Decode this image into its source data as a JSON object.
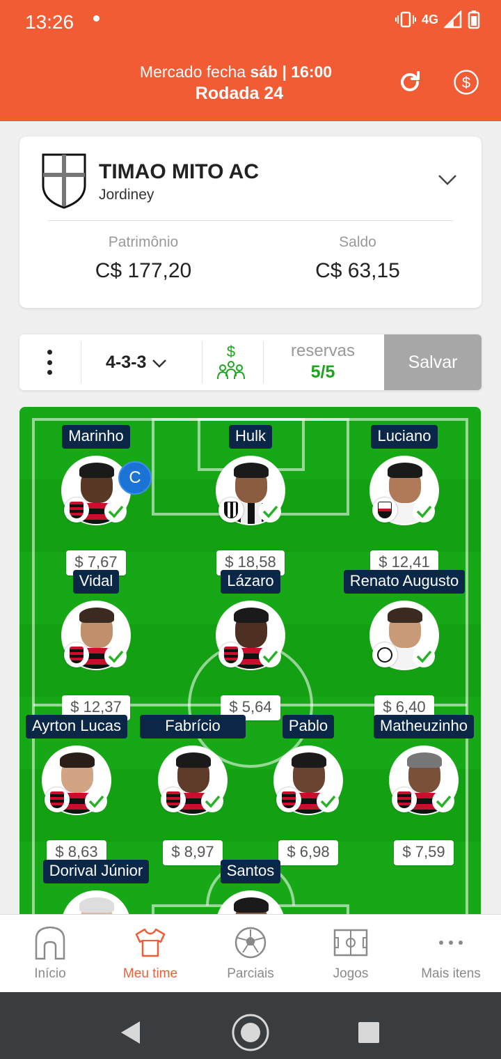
{
  "status_bar": {
    "time": "13:26",
    "network": "4G"
  },
  "header": {
    "market_label": "Mercado fecha",
    "market_time": "sáb | 16:00",
    "round": "Rodada 24"
  },
  "team": {
    "name": "TIMAO MITO AC",
    "owner": "Jordiney",
    "patrimonio_label": "Patrimônio",
    "patrimonio_value": "C$ 177,20",
    "saldo_label": "Saldo",
    "saldo_value": "C$ 63,15"
  },
  "toolbar": {
    "formation": "4-3-3",
    "reserves_label": "reservas",
    "reserves_value": "5/5",
    "save_label": "Salvar"
  },
  "players": [
    {
      "name": "Marinho",
      "price": "$ 7,67",
      "club": "fla",
      "captain": "C"
    },
    {
      "name": "Hulk",
      "price": "$ 18,58",
      "club": "cam"
    },
    {
      "name": "Luciano",
      "price": "$ 12,41",
      "club": "spfc"
    },
    {
      "name": "Vidal",
      "price": "$ 12,37",
      "club": "fla"
    },
    {
      "name": "Lázaro",
      "price": "$ 5,64",
      "club": "fla"
    },
    {
      "name": "Renato Augusto",
      "price": "$ 6,40",
      "club": "sccp"
    },
    {
      "name": "Ayrton Lucas",
      "price": "$ 8,63",
      "club": "fla"
    },
    {
      "name": "Fabrício",
      "price": "$ 8,97",
      "club": "fla"
    },
    {
      "name": "Pablo",
      "price": "$ 6,98",
      "club": "fla"
    },
    {
      "name": "Matheuzinho",
      "price": "$ 7,59",
      "club": "fla"
    },
    {
      "name": "Dorival Júnior",
      "price": "",
      "club": "fla"
    },
    {
      "name": "Santos",
      "price": "",
      "club": "fla"
    }
  ],
  "nav": {
    "items": [
      {
        "label": "Início",
        "icon": "home-icon"
      },
      {
        "label": "Meu time",
        "icon": "shirt-icon"
      },
      {
        "label": "Parciais",
        "icon": "ball-icon"
      },
      {
        "label": "Jogos",
        "icon": "field-icon"
      },
      {
        "label": "Mais itens",
        "icon": "more-icon"
      }
    ],
    "active": "Meu time"
  },
  "colors": {
    "brand": "#f25c35",
    "pitch": "#17a817",
    "label_bg": "#0b2747",
    "captain": "#1c73d6",
    "reserves": "#1ea51e"
  }
}
